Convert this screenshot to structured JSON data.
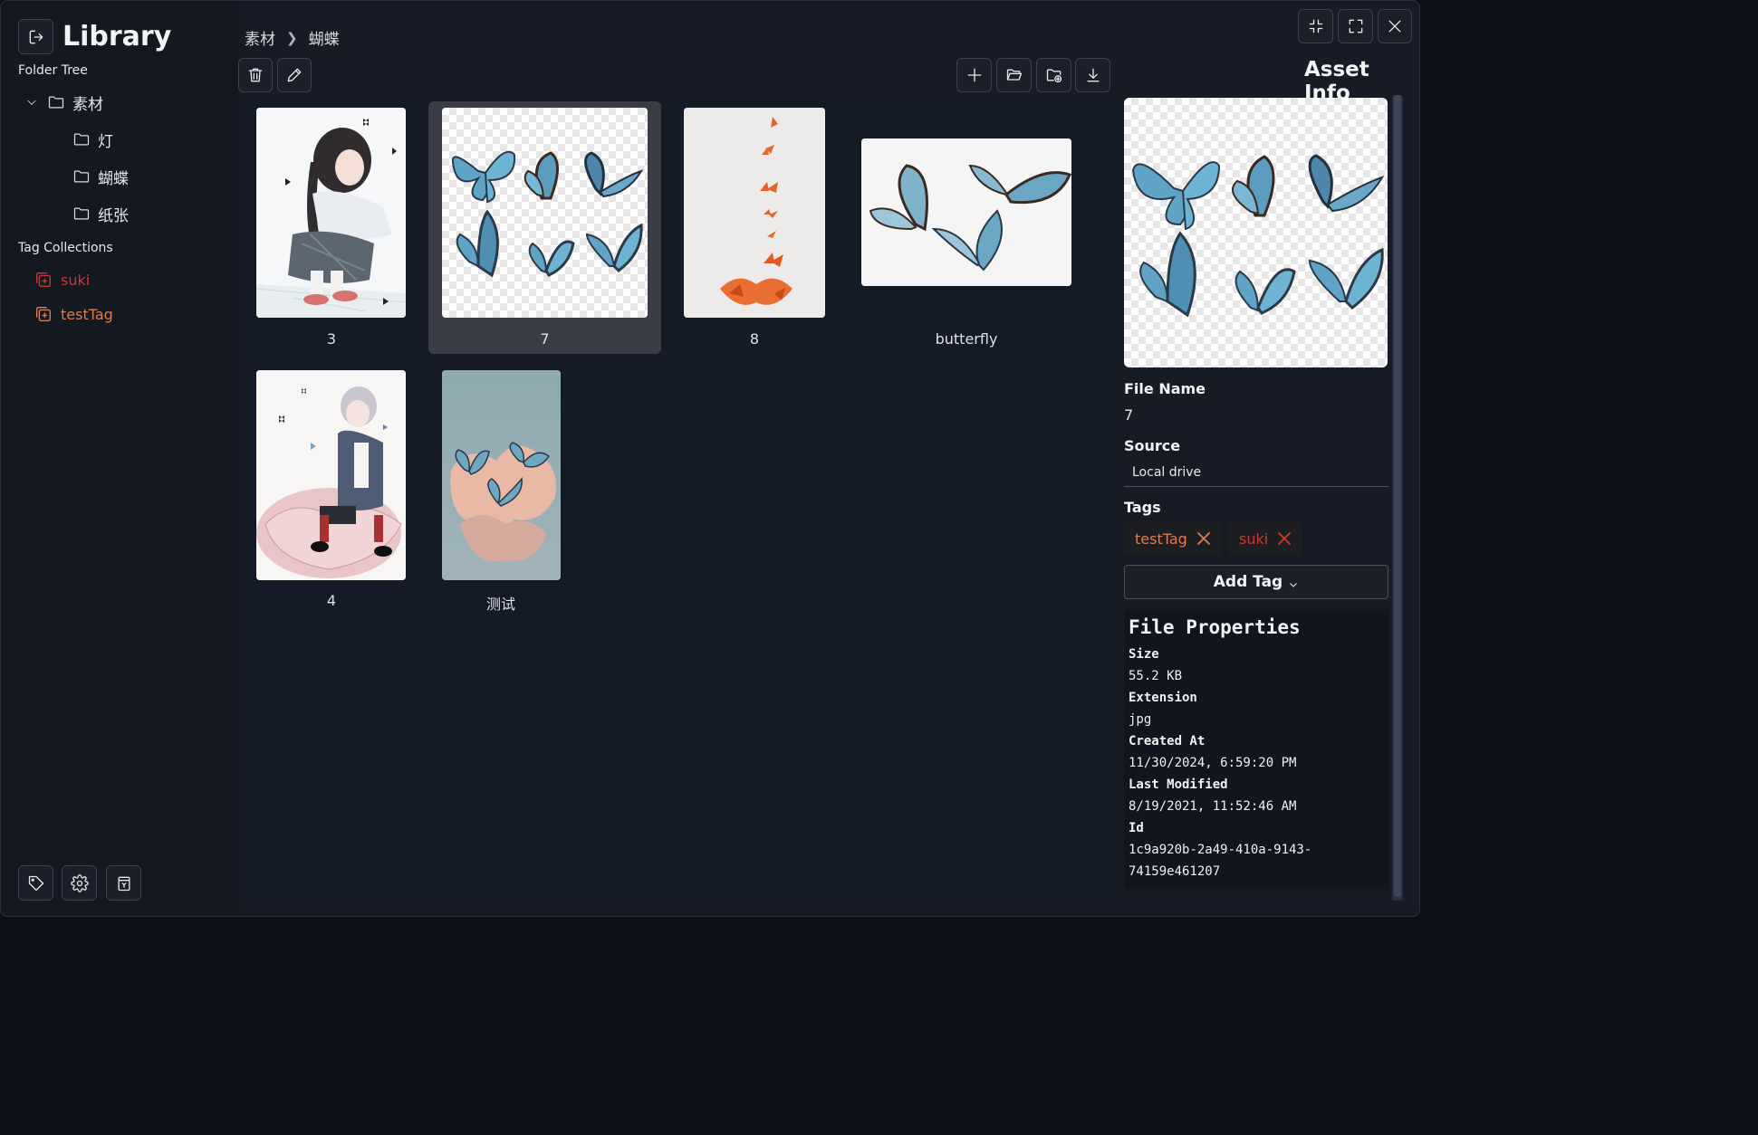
{
  "sidebar": {
    "title": "Library",
    "folder_tree_label": "Folder Tree",
    "folders": [
      {
        "label": "素材",
        "expanded": true
      },
      {
        "label": "灯"
      },
      {
        "label": "蝴蝶"
      },
      {
        "label": "纸张"
      }
    ],
    "tag_collections_label": "Tag Collections",
    "tags": [
      {
        "label": "suki",
        "color": "#c73a33"
      },
      {
        "label": "testTag",
        "color": "#e07b52"
      }
    ]
  },
  "breadcrumb": [
    "素材",
    "蝴蝶"
  ],
  "assets": [
    {
      "label": "3",
      "kind": "anime-girl-squatting",
      "selected": false
    },
    {
      "label": "7",
      "kind": "butterflies-transparent",
      "selected": true
    },
    {
      "label": "8",
      "kind": "orange-butterflies",
      "selected": false
    },
    {
      "label": "butterfly",
      "kind": "three-butterflies",
      "selected": false
    },
    {
      "label": "4",
      "kind": "anime-girl-flower",
      "selected": false
    },
    {
      "label": "测试",
      "kind": "butterflies-clouds",
      "selected": false
    }
  ],
  "asset_info": {
    "title": "Asset Info",
    "file_name_label": "File Name",
    "file_name": "7",
    "source_label": "Source",
    "source": "Local drive",
    "tags_label": "Tags",
    "tags": [
      {
        "label": "testTag",
        "color": "#e07b52"
      },
      {
        "label": "suki",
        "color": "#c73a33"
      }
    ],
    "add_tag_label": "Add Tag",
    "properties": {
      "heading": "File Properties",
      "size_label": "Size",
      "size": "55.2 KB",
      "extension_label": "Extension",
      "extension": "jpg",
      "created_label": "Created At",
      "created": "11/30/2024, 6:59:20 PM",
      "modified_label": "Last Modified",
      "modified": "8/19/2021, 11:52:46 AM",
      "id_label": "Id",
      "id_line1": "1c9a920b-2a49-410a-9143-",
      "id_line2": "74159e461207"
    }
  },
  "icons": {
    "exit": "exit-icon",
    "trash": "trash-icon",
    "edit": "pencil-icon",
    "add": "plus-icon",
    "open_folder": "folder-open-icon",
    "add_folder": "folder-add-icon",
    "download": "download-icon",
    "minimize": "collapse-icon",
    "maximize": "expand-icon",
    "close": "close-icon",
    "tag": "tag-icon",
    "settings": "gear-icon",
    "recycle": "recycle-bin-icon"
  }
}
